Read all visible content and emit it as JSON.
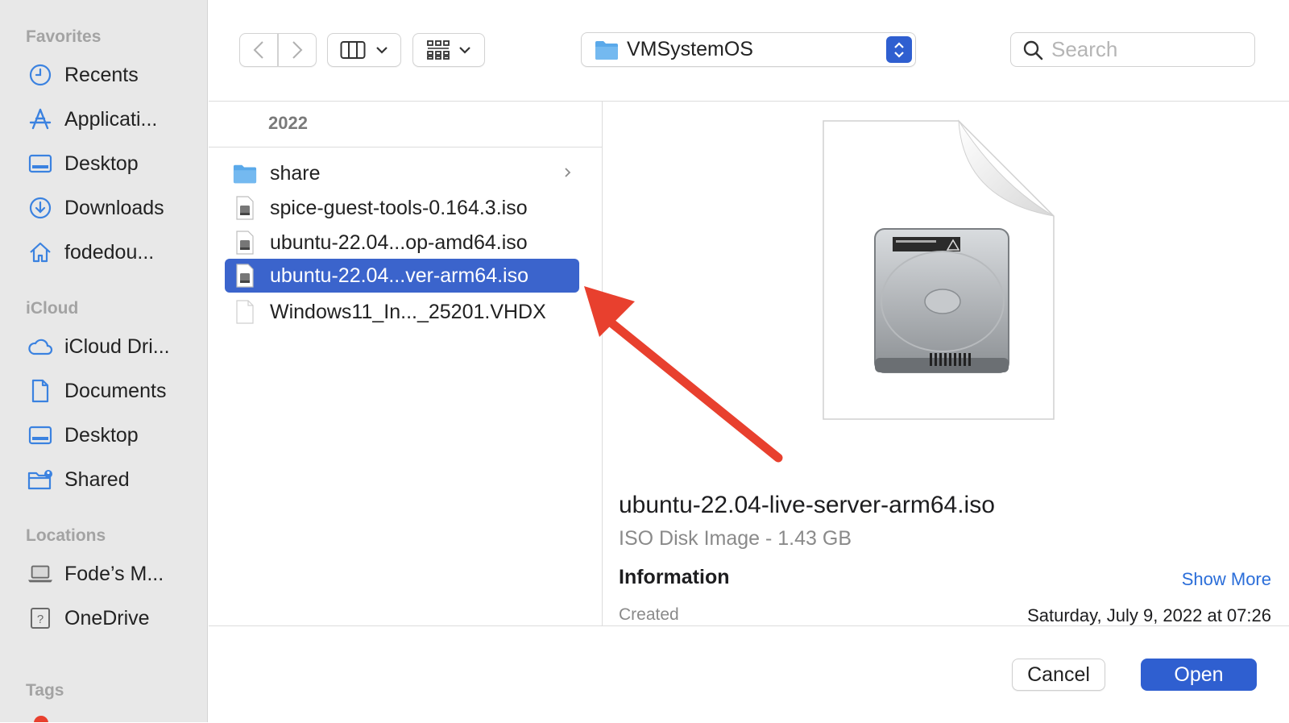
{
  "sidebar": {
    "favorites_heading": "Favorites",
    "favorites": [
      {
        "label": "Recents",
        "icon": "clock-icon"
      },
      {
        "label": "Applicati...",
        "icon": "applications-icon"
      },
      {
        "label": "Desktop",
        "icon": "desktop-icon"
      },
      {
        "label": "Downloads",
        "icon": "downloads-icon"
      },
      {
        "label": "fodedou...",
        "icon": "home-icon"
      }
    ],
    "icloud_heading": "iCloud",
    "icloud": [
      {
        "label": "iCloud Dri...",
        "icon": "cloud-icon"
      },
      {
        "label": "Documents",
        "icon": "document-icon"
      },
      {
        "label": "Desktop",
        "icon": "desktop-icon"
      },
      {
        "label": "Shared",
        "icon": "shared-folder-icon"
      }
    ],
    "locations_heading": "Locations",
    "locations": [
      {
        "label": "Fode’s M...",
        "icon": "laptop-icon"
      },
      {
        "label": "OneDrive",
        "icon": "question-drive-icon"
      }
    ],
    "tags_heading": "Tags"
  },
  "toolbar": {
    "path": "VMSystemOS",
    "search_placeholder": "Search"
  },
  "column": {
    "header": "2022",
    "files": [
      {
        "name": "share",
        "kind": "folder"
      },
      {
        "name": "spice-guest-tools-0.164.3.iso",
        "kind": "iso"
      },
      {
        "name": "ubuntu-22.04...op-amd64.iso",
        "kind": "iso"
      },
      {
        "name": "ubuntu-22.04...ver-arm64.iso",
        "kind": "iso",
        "selected": true
      },
      {
        "name": "Windows11_In..._25201.VHDX",
        "kind": "blank"
      }
    ]
  },
  "preview": {
    "name": "ubuntu-22.04-live-server-arm64.iso",
    "kind": "ISO Disk Image - 1.43 GB",
    "info_heading": "Information",
    "show_more": "Show More",
    "created_label": "Created",
    "created_value": "Saturday, July 9, 2022 at 07:26"
  },
  "buttons": {
    "cancel": "Cancel",
    "open": "Open"
  },
  "colors": {
    "accent": "#3b64cc",
    "arrow": "#e8402e",
    "folder": "#5aa9ea"
  }
}
